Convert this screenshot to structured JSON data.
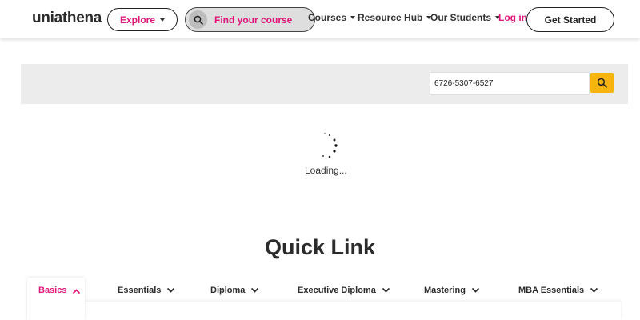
{
  "header": {
    "logo": "uniathena",
    "explore_label": "Explore",
    "search_placeholder": "Find your course",
    "nav": [
      "Courses",
      "Resource Hub",
      "Our Students"
    ],
    "login_label": "Log in",
    "cta_label": "Get Started"
  },
  "verify": {
    "value": "6726-5307-6527"
  },
  "status": {
    "loading_text": "Loading..."
  },
  "quick_links": {
    "title": "Quick Link",
    "tabs": [
      "Basics",
      "Essentials",
      "Diploma",
      "Executive Diploma",
      "Mastering",
      "MBA Essentials"
    ],
    "active_tab": "Basics"
  },
  "colors": {
    "brand_pink": "#e0157a",
    "search_yellow": "#f6b40c",
    "panel_gray": "#ececec"
  },
  "icons": [
    "search-icon",
    "chevron-down-icon",
    "chevron-up-icon",
    "caret-down-icon",
    "spinner-icon"
  ]
}
